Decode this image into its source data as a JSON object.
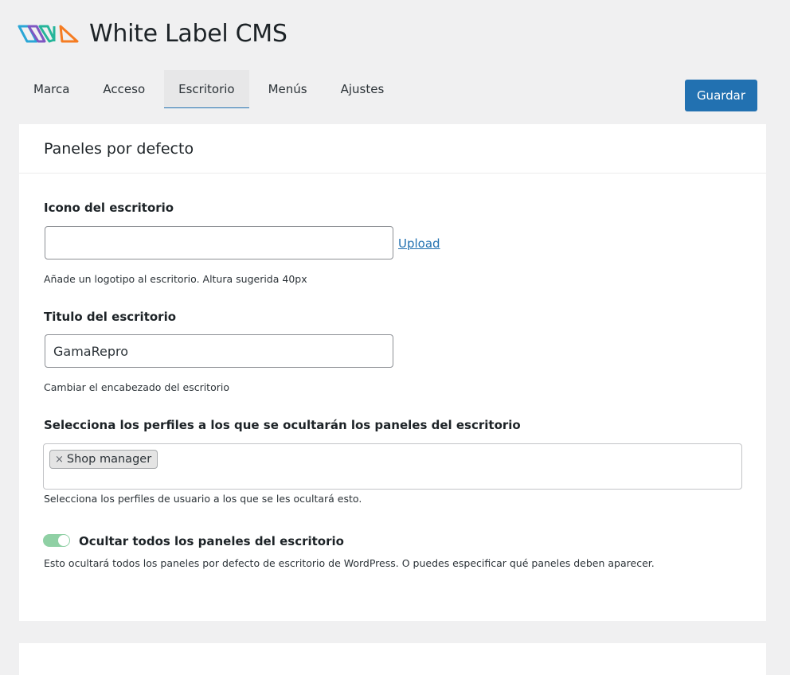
{
  "header": {
    "title": "White Label CMS",
    "logo_icon": "white-label-cms-logo-icon"
  },
  "tabs": [
    {
      "label": "Marca"
    },
    {
      "label": "Acceso"
    },
    {
      "label": "Escritorio"
    },
    {
      "label": "Menús"
    },
    {
      "label": "Ajustes"
    }
  ],
  "active_tab": "Escritorio",
  "save_label": "Guardar",
  "panel": {
    "title": "Paneles por defecto",
    "icon_field": {
      "label": "Icono del escritorio",
      "value": "",
      "upload_label": "Upload",
      "help": "Añade un logotipo al escritorio. Altura sugerida 40px"
    },
    "title_field": {
      "label": "Titulo del escritorio",
      "value": "GamaRepro",
      "help": "Cambiar el encabezado del escritorio"
    },
    "roles_field": {
      "label": "Selecciona los perfiles a los que se ocultarán los paneles del escritorio",
      "chips": [
        {
          "remove": "×",
          "label": "Shop manager"
        }
      ],
      "help": "Selecciona los perfiles de usuario a los que se les ocultará esto."
    },
    "hide_all": {
      "label": "Ocultar todos los paneles del escritorio",
      "enabled": true,
      "help": "Esto ocultará todos los paneles por defecto de escritorio de WordPress. O puedes especificar qué paneles deben aparecer."
    }
  },
  "colors": {
    "accent": "#2271b1",
    "toggle_on": "#8fd0a4",
    "background": "#f0f0f1"
  }
}
